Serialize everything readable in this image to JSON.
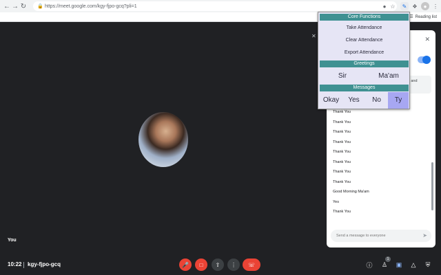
{
  "browser": {
    "url": "https://meet.google.com/kgy-fjpo-gcq?pli=1",
    "reading_list": "Reading list"
  },
  "meet": {
    "participant_label": "You",
    "time": "10:22",
    "meeting_code": "kgy-fjpo-gcq",
    "people_count": "1"
  },
  "chat": {
    "info_text": "e call and",
    "messages": [
      "Thank You",
      "Thank You",
      "Thank You",
      "Thank You",
      "Thank You",
      "Thank You",
      "Thank You",
      "Thank You",
      "Good Morning Ma'am",
      "Yes",
      "Thank You"
    ],
    "input_placeholder": "Send a message to everyone"
  },
  "popup": {
    "core_header": "Core Functions",
    "take_attendance": "Take Attendance",
    "clear_attendance": "Clear Attendance",
    "export_attendance": "Export Attendance",
    "greetings_header": "Greetings",
    "sir": "Sir",
    "maam": "Ma'am",
    "messages_header": "Messages",
    "okay": "Okay",
    "yes": "Yes",
    "no": "No",
    "ty": "Ty"
  },
  "colors": {
    "popup_bg": "#e6e5f5",
    "section_header": "#3f9192",
    "selected_button": "#a7a7f2",
    "meet_bg": "#202124",
    "end_call": "#ea4335"
  },
  "icons": [
    "back-arrow-icon",
    "forward-arrow-icon",
    "reload-icon",
    "lock-icon",
    "camera-blocked-icon",
    "star-icon",
    "extension-pen-icon",
    "puzzle-icon",
    "profile-icon",
    "reading-list-icon",
    "mic-off-icon",
    "camera-off-icon",
    "present-icon",
    "more-options-icon",
    "end-call-icon",
    "info-icon",
    "people-icon",
    "chat-icon",
    "activities-icon",
    "host-controls-icon",
    "close-icon",
    "send-icon"
  ]
}
